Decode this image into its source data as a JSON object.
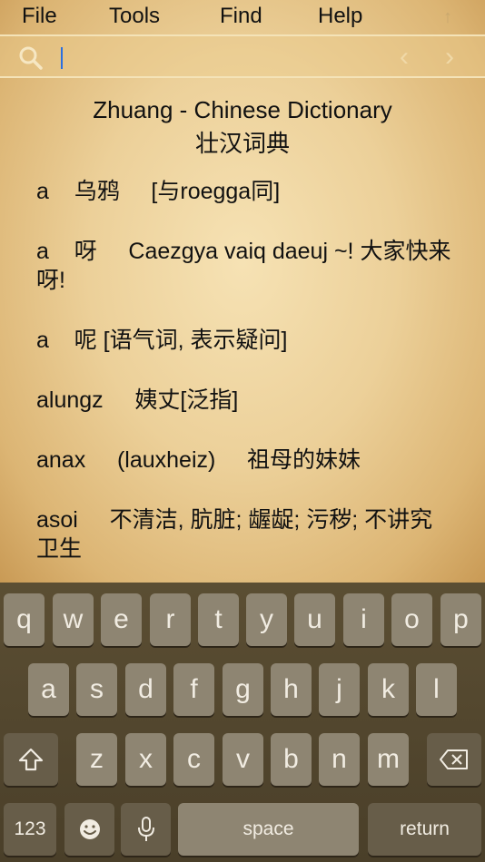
{
  "menu": {
    "file": "File",
    "tools": "Tools",
    "find": "Find",
    "help": "Help"
  },
  "search": {
    "value": "",
    "placeholder": ""
  },
  "dictionary": {
    "title_en": "Zhuang - Chinese Dictionary",
    "title_zh": "壮汉词典"
  },
  "entries": [
    {
      "word": "a",
      "text": "    乌鸦     [与roegga同]"
    },
    {
      "word": "a",
      "text": "    呀     Caezgya vaiq daeuj ~! 大家快来呀!"
    },
    {
      "word": "a",
      "text": "    呢 [语气词, 表示疑问]"
    },
    {
      "word": "alungz",
      "text": "     姨丈[泛指]"
    },
    {
      "word": "anax",
      "text": "     (lauxheiz)     祖母的妹妹"
    },
    {
      "word": "asoi",
      "text": "     不清洁, 肮脏; 龌龊; 污秽; 不讲究卫生"
    }
  ],
  "keyboard": {
    "row1": [
      "q",
      "w",
      "e",
      "r",
      "t",
      "y",
      "u",
      "i",
      "o",
      "p"
    ],
    "row2": [
      "a",
      "s",
      "d",
      "f",
      "g",
      "h",
      "j",
      "k",
      "l"
    ],
    "row3": [
      "z",
      "x",
      "c",
      "v",
      "b",
      "n",
      "m"
    ],
    "numbers": "123",
    "space": "space",
    "return": "return"
  },
  "icons": {
    "search": "magnifier-icon",
    "prev": "chevron-left-icon",
    "next": "chevron-right-icon",
    "up": "arrow-up-icon",
    "shift": "shift-icon",
    "delete": "delete-icon",
    "emoji": "emoji-icon",
    "mic": "microphone-icon"
  },
  "colors": {
    "accent": "#2b6fe0",
    "keyboard_bg": "#4e432c",
    "key": "#8e8572"
  }
}
